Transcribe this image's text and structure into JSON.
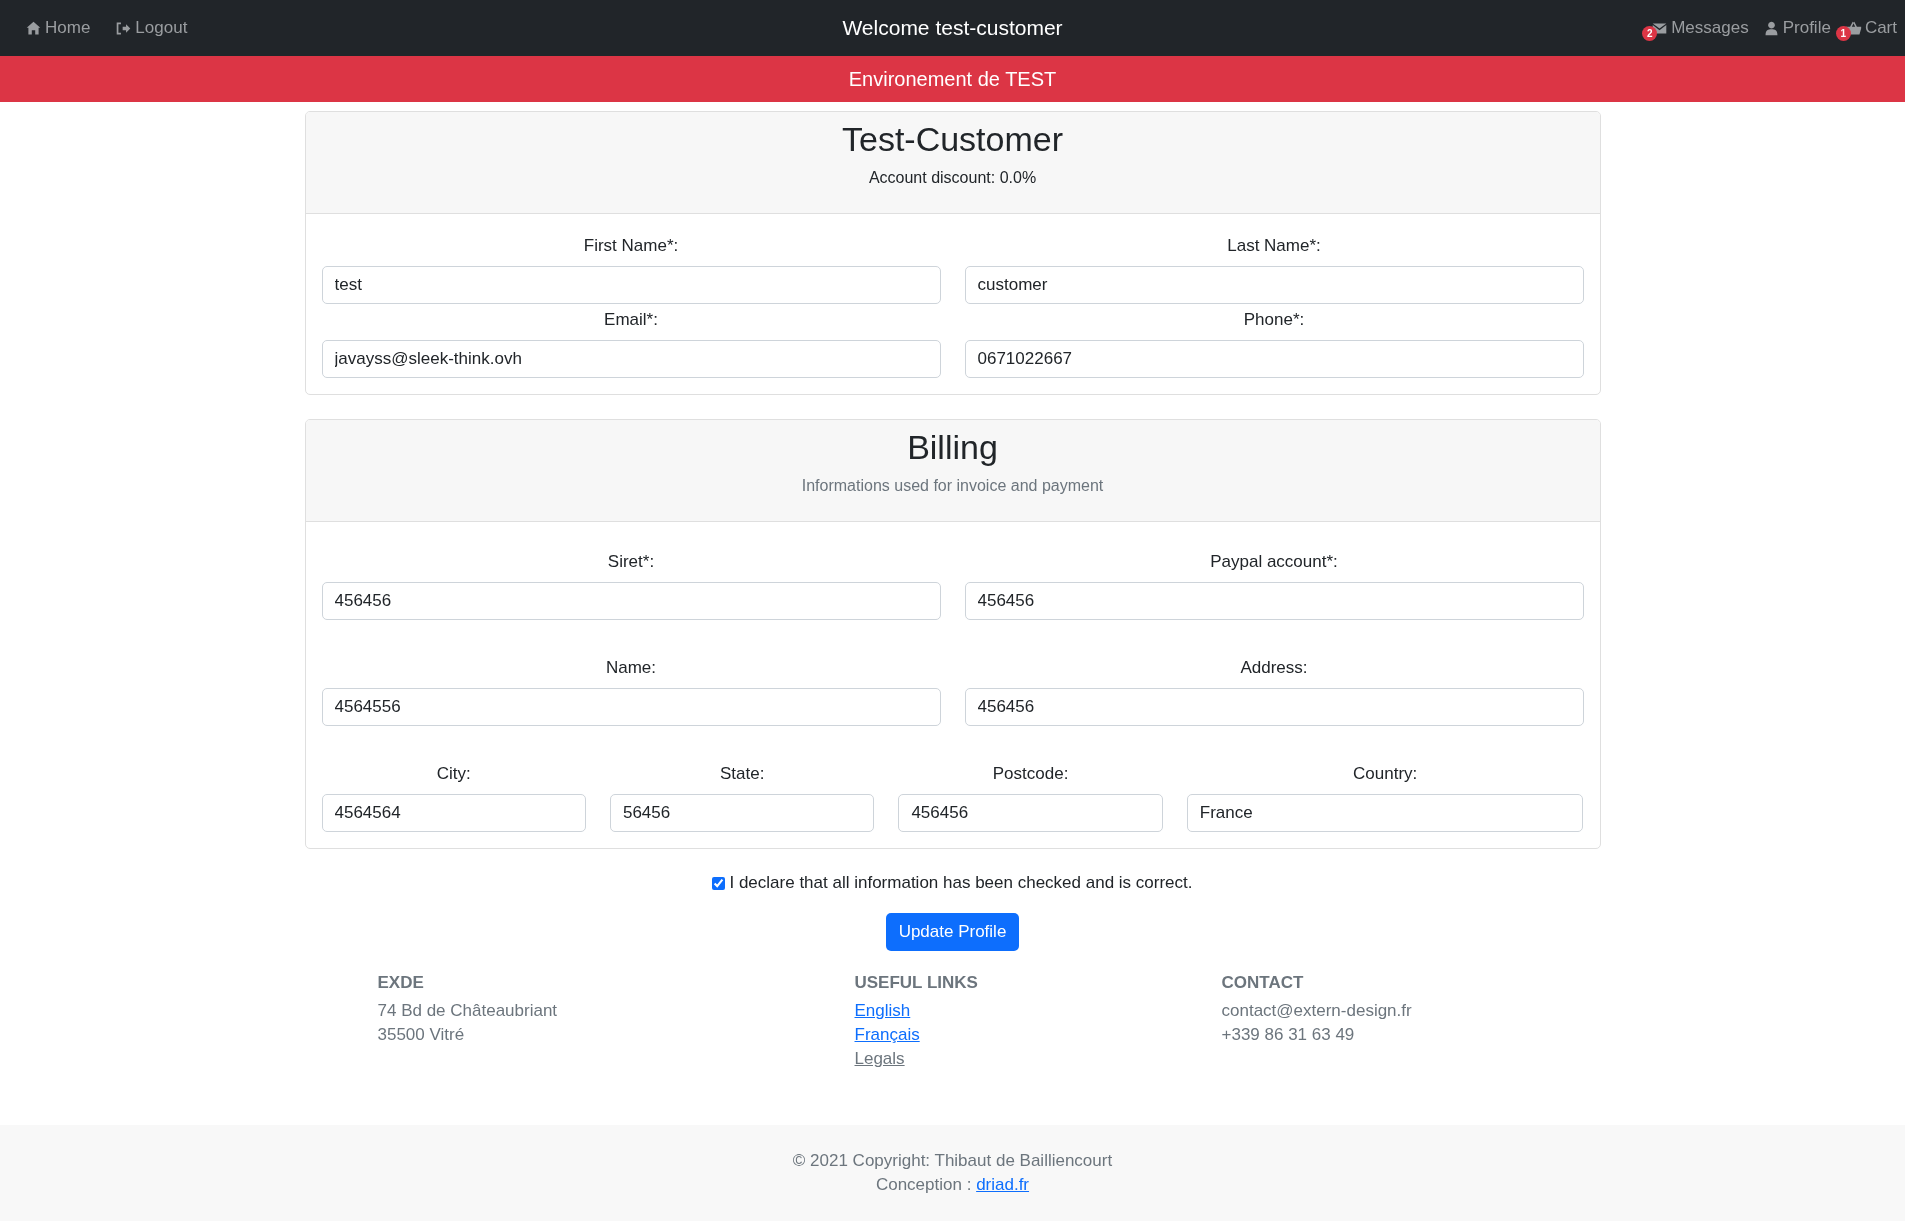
{
  "navbar": {
    "left": [
      {
        "label": "Home"
      },
      {
        "label": "Logout"
      }
    ],
    "title": "Welcome test-customer",
    "right": [
      {
        "label": "Messages",
        "badge": "2"
      },
      {
        "label": "Profile"
      },
      {
        "label": "Cart",
        "badge": "1"
      }
    ]
  },
  "banner": "Environement de TEST",
  "cards": [
    {
      "title": "Test-Customer",
      "subtitle": "Account discount: 0.0%",
      "rows": [
        [
          {
            "label": "First Name*:",
            "value": "test"
          },
          {
            "label": "Last Name*:",
            "value": "customer"
          }
        ],
        [
          {
            "label": "Email*:",
            "value": "javayss@sleek-think.ovh"
          },
          {
            "label": "Phone*:",
            "value": "0671022667"
          }
        ]
      ]
    },
    {
      "title": "Billing",
      "subtitle": "Informations used for invoice and payment",
      "rows": [
        [
          {
            "label": "Siret*:",
            "value": "456456"
          },
          {
            "label": "Paypal account*:",
            "value": "456456"
          }
        ],
        [
          {
            "label": "Name:",
            "value": "4564556"
          },
          {
            "label": "Address:",
            "value": "456456"
          }
        ],
        [
          {
            "label": "City:",
            "value": "4564564"
          },
          {
            "label": "State:",
            "value": "56456"
          },
          {
            "label": "Postcode:",
            "value": "456456"
          },
          {
            "label": "Country:",
            "value": "France"
          }
        ]
      ]
    }
  ],
  "declaration": {
    "label": "I declare that all information has been checked and is correct.",
    "checked": true
  },
  "submit": "Update Profile",
  "footer": {
    "columns": [
      {
        "heading": "EXDE",
        "lines": [
          {
            "text": "74 Bd de Châteaubriant",
            "kind": "text"
          },
          {
            "text": "35500 Vitré",
            "kind": "text"
          }
        ]
      },
      {
        "heading": "USEFUL LINKS",
        "lines": [
          {
            "text": "English",
            "kind": "link"
          },
          {
            "text": "Français",
            "kind": "link"
          },
          {
            "text": "Legals",
            "kind": "muted-link"
          }
        ]
      },
      {
        "heading": "CONTACT",
        "lines": [
          {
            "text": "contact@extern-design.fr",
            "kind": "text"
          },
          {
            "text": "+339 86 31 63 49",
            "kind": "text"
          }
        ]
      }
    ],
    "copyright": "© 2021 Copyright: Thibaut de Bailliencourt",
    "conception": "Conception :",
    "conception_link": "driad.fr"
  }
}
